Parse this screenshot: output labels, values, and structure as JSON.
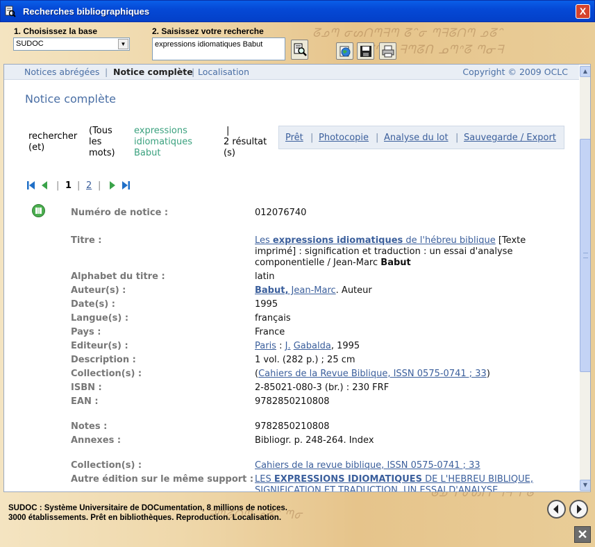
{
  "window": {
    "title": "Recherches bibliographiques",
    "close_glyph": "X"
  },
  "search": {
    "base_label": "1. Choisissez la base",
    "base_value": "SUDOC",
    "query_label": "2. Saisissez votre recherche",
    "query_value": "expressions idiomatiques Babut"
  },
  "toolbar": {
    "icons": [
      "search-icon",
      "web-icon",
      "save-icon",
      "print-icon"
    ]
  },
  "nav": {
    "items": [
      "Notices abrégées",
      "Notice complète",
      "Localisation"
    ],
    "sep": "|",
    "active_index": 1,
    "copyright": "Copyright © 2009 OCLC"
  },
  "page": {
    "heading": "Notice complète"
  },
  "criteria": {
    "search_label": "rechercher (et)",
    "mode": "(Tous les mots)",
    "terms": "expressions idiomatiques Babut",
    "pipe": "|",
    "results": "2 résultat (s)"
  },
  "actions": {
    "items": [
      "Prêt",
      "Photocopie",
      "Analyse du lot",
      "Sauvegarde / Export"
    ],
    "sep": "|"
  },
  "pager": {
    "current": "1",
    "next_page": "2",
    "sep": "|"
  },
  "record": {
    "numero": {
      "label": "Numéro de notice :",
      "value": "012076740"
    },
    "titre": {
      "label": "Titre :",
      "link_pre": "Les ",
      "link_bold": "expressions idiomatiques",
      "link_post": " de l'hébreu biblique",
      "rest": " [Texte imprimé] : signification et traduction : un essai d'analyse componentielle / Jean-Marc ",
      "author_bold": "Babut"
    },
    "alphabet": {
      "label": "Alphabet du titre :",
      "value": "latin"
    },
    "auteur": {
      "label": "Auteur(s) :",
      "link_bold": "Babut,",
      "link": " Jean-Marc",
      "rest": ". Auteur"
    },
    "dates": {
      "label": "Date(s) :",
      "value": "1995"
    },
    "langue": {
      "label": "Langue(s) :",
      "value": "français"
    },
    "pays": {
      "label": "Pays :",
      "value": "France"
    },
    "editeur": {
      "label": "Editeur(s) :",
      "place": "Paris",
      "sep": " : ",
      "initial": "J.",
      "name": "Gabalda",
      "rest": ", 1995"
    },
    "description": {
      "label": "Description :",
      "value": "1 vol. (282 p.) ; 25 cm"
    },
    "collection": {
      "label": "Collection(s) :",
      "open": "(",
      "link": "Cahiers de la Revue Biblique, ISSN 0575-0741 ; 33",
      "close": ")"
    },
    "isbn": {
      "label": "ISBN :",
      "value": "2-85021-080-3 (br.) : 230 FRF"
    },
    "ean": {
      "label": "EAN :",
      "value": "9782850210808"
    },
    "notes": {
      "label": "Notes :",
      "value": "9782850210808"
    },
    "annexes": {
      "label": "Annexes :",
      "value": "Bibliogr. p. 248-264. Index"
    },
    "collection2": {
      "label": "Collection(s) :",
      "link": "Cahiers de la revue biblique, ISSN 0575-0741 ; 33"
    },
    "autre": {
      "label": "Autre édition sur le même support :",
      "link_pre": "LES ",
      "link_bold": "EXPRESSIONS IDIOMATIQUES",
      "link_post": " DE L'HEBREU BIBLIQUE, SIGNIFICATION ET TRADUCTION. UN ESSAI D'ANALYSE"
    }
  },
  "footer": {
    "line1": "SUDOC : Système Universitaire de DOCumentation, 8 millions de notices.",
    "line2": "3000 établissements. Prêt en bibliothèques. Reproduction. Localisation.",
    "close_glyph": "✕"
  },
  "colors": {
    "accent": "#4a6fa5",
    "link": "#3b5f9c",
    "green": "#3aa17e",
    "titlebar": "#0549d6"
  }
}
